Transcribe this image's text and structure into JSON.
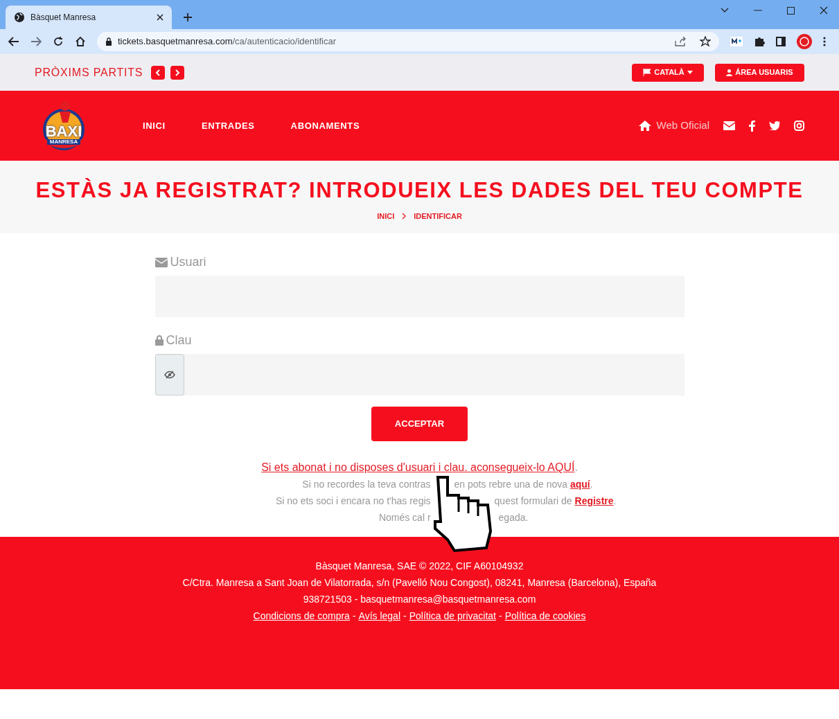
{
  "browser": {
    "tab_title": "Bàsquet Manresa",
    "url_host": "tickets.basquetmanresa.com",
    "url_path": "/ca/autenticacio/identificar"
  },
  "topbar": {
    "next_matches": "PRÒXIMS PARTITS",
    "language_button": "CATALÀ",
    "user_area_button": "ÁREA USUARIS"
  },
  "header": {
    "logo_text": "BAXI",
    "logo_subtext": "MANRESA",
    "nav": [
      {
        "label": "INICI"
      },
      {
        "label": "ENTRADES"
      },
      {
        "label": "ABONAMENTS"
      }
    ],
    "official_link": "Web Oficial"
  },
  "title_band": {
    "title": "ESTÀS JA REGISTRAT? INTRODUEIX LES DADES DEL TEU COMPTE",
    "breadcrumb": [
      "INICI",
      "IDENTIFICAR"
    ]
  },
  "form": {
    "user_label": "Usuari",
    "password_label": "Clau",
    "submit": "ACCEPTAR"
  },
  "help": {
    "subscriber_link": "Si ets abonat i no disposes d'usuari i clau. aconsegueix-lo AQUÍ",
    "subscriber_suffix": ".",
    "lines": [
      {
        "left": "Si no recordes la teva contras",
        "right": "en pots rebre una de nova ",
        "link": "aquí",
        "suffix": "."
      },
      {
        "left": "Si no ets soci i encara no t'has regis",
        "right": "quest formulari de ",
        "link": "Registre",
        "suffix": "."
      },
      {
        "left": "Només cal r",
        "right": "egada."
      }
    ]
  },
  "footer": {
    "lines": [
      "Bàsquet Manresa, SAE © 2022, CIF A60104932",
      "C/Ctra. Manresa a Sant Joan de Vilatorrada, s/n (Pavelló Nou Congost), 08241, Manresa (Barcelona), España",
      "938721503 - basquetmanresa@basquetmanresa.com"
    ],
    "links": [
      "Condicions de compra",
      "Avís legal",
      "Política de privacitat",
      "Política de cookies"
    ],
    "separator": "-"
  }
}
